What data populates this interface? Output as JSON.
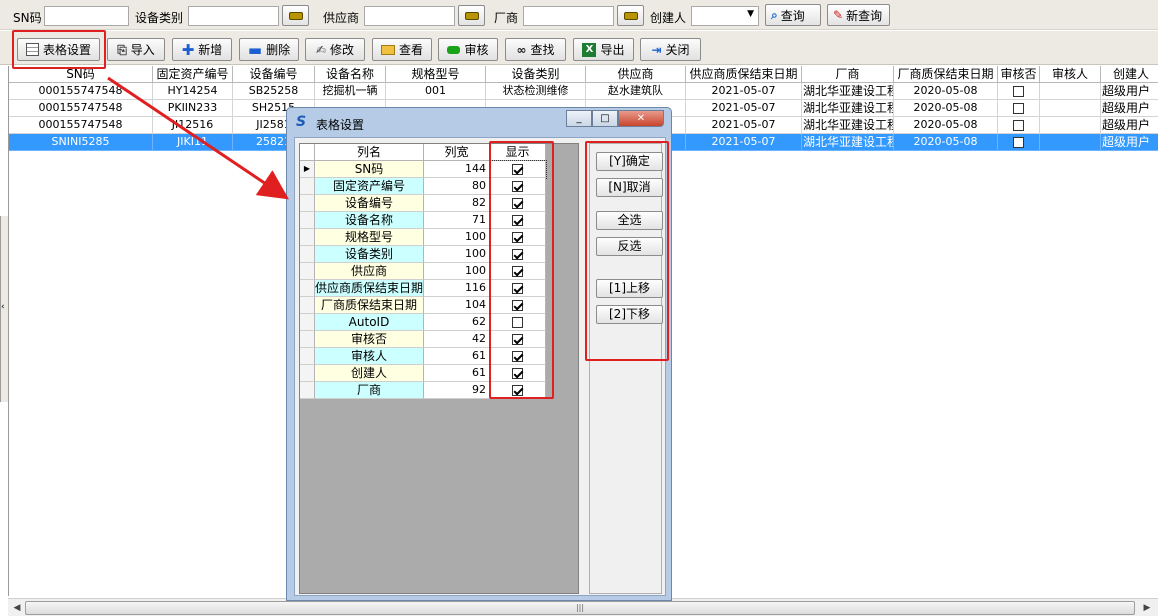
{
  "filter": {
    "sn_label": "SN码",
    "category_label": "设备类别",
    "supplier_label": "供应商",
    "maker_label": "厂商",
    "creator_label": "创建人",
    "sn_value": "",
    "category_value": "",
    "supplier_value": "",
    "maker_value": "",
    "creator_value": "",
    "query_label": "查询",
    "new_query_label": "新查询"
  },
  "toolbar": {
    "table_settings": "表格设置",
    "import": "导入",
    "add": "新增",
    "delete": "删除",
    "modify": "修改",
    "view": "查看",
    "audit": "审核",
    "find": "查找",
    "export": "导出",
    "close": "关闭"
  },
  "grid": {
    "columns": [
      "SN码",
      "固定资产编号",
      "设备编号",
      "设备名称",
      "规格型号",
      "设备类别",
      "供应商",
      "供应商质保结束日期",
      "厂商",
      "厂商质保结束日期",
      "审核否",
      "审核人",
      "创建人"
    ],
    "rows": [
      {
        "sn": "000155747548",
        "asset": "HY14254",
        "device": "SB25258",
        "name": "挖掘机一辆",
        "model": "001",
        "category": "状态检测维修",
        "supplier": "赵水建筑队",
        "sup_end": "2021-05-07",
        "maker": "湖北华亚建设工程",
        "maker_end": "2020-05-08",
        "audited": false,
        "auditor": "",
        "creator": "超级用户"
      },
      {
        "sn": "000155747548",
        "asset": "PKIIN233",
        "device": "SH2515",
        "name": "",
        "model": "",
        "category": "",
        "supplier": "",
        "sup_end": "2021-05-07",
        "maker": "湖北华亚建设工程",
        "maker_end": "2020-05-08",
        "audited": false,
        "auditor": "",
        "creator": "超级用户"
      },
      {
        "sn": "000155747548",
        "asset": "JI12516",
        "device": "JI2581",
        "name": "",
        "model": "",
        "category": "",
        "supplier": "",
        "sup_end": "2021-05-07",
        "maker": "湖北华亚建设工程",
        "maker_end": "2020-05-08",
        "audited": false,
        "auditor": "",
        "creator": "超级用户"
      },
      {
        "sn": "SNINI5285",
        "asset": "JIKI11",
        "device": "25821",
        "name": "",
        "model": "",
        "category": "",
        "supplier": "",
        "sup_end": "2021-05-07",
        "maker": "湖北华亚建设工程",
        "maker_end": "2020-05-08",
        "audited": false,
        "auditor": "",
        "creator": "超级用户"
      }
    ]
  },
  "dialog": {
    "title": "表格设置",
    "headers": [
      "列名",
      "列宽",
      "显示"
    ],
    "rows": [
      {
        "name": "SN码",
        "width": "144",
        "show": true
      },
      {
        "name": "固定资产编号",
        "width": "80",
        "show": true
      },
      {
        "name": "设备编号",
        "width": "82",
        "show": true
      },
      {
        "name": "设备名称",
        "width": "71",
        "show": true
      },
      {
        "name": "规格型号",
        "width": "100",
        "show": true
      },
      {
        "name": "设备类别",
        "width": "100",
        "show": true
      },
      {
        "name": "供应商",
        "width": "100",
        "show": true
      },
      {
        "name": "供应商质保结束日期",
        "width": "116",
        "show": true
      },
      {
        "name": "厂商质保结束日期",
        "width": "104",
        "show": true
      },
      {
        "name": "AutoID",
        "width": "62",
        "show": false
      },
      {
        "name": "审核否",
        "width": "42",
        "show": true
      },
      {
        "name": "审核人",
        "width": "61",
        "show": true
      },
      {
        "name": "创建人",
        "width": "61",
        "show": true
      },
      {
        "name": "厂商",
        "width": "92",
        "show": true
      }
    ],
    "buttons": {
      "ok": "[Y]确定",
      "cancel": "[N]取消",
      "select_all": "全选",
      "invert": "反选",
      "move_up": "[1]上移",
      "move_down": "[2]下移"
    }
  },
  "colors": {
    "selection": "#3399ff",
    "row_alt": "#ccffff",
    "row_base": "#ffffe1",
    "annotation": "#e02020"
  }
}
